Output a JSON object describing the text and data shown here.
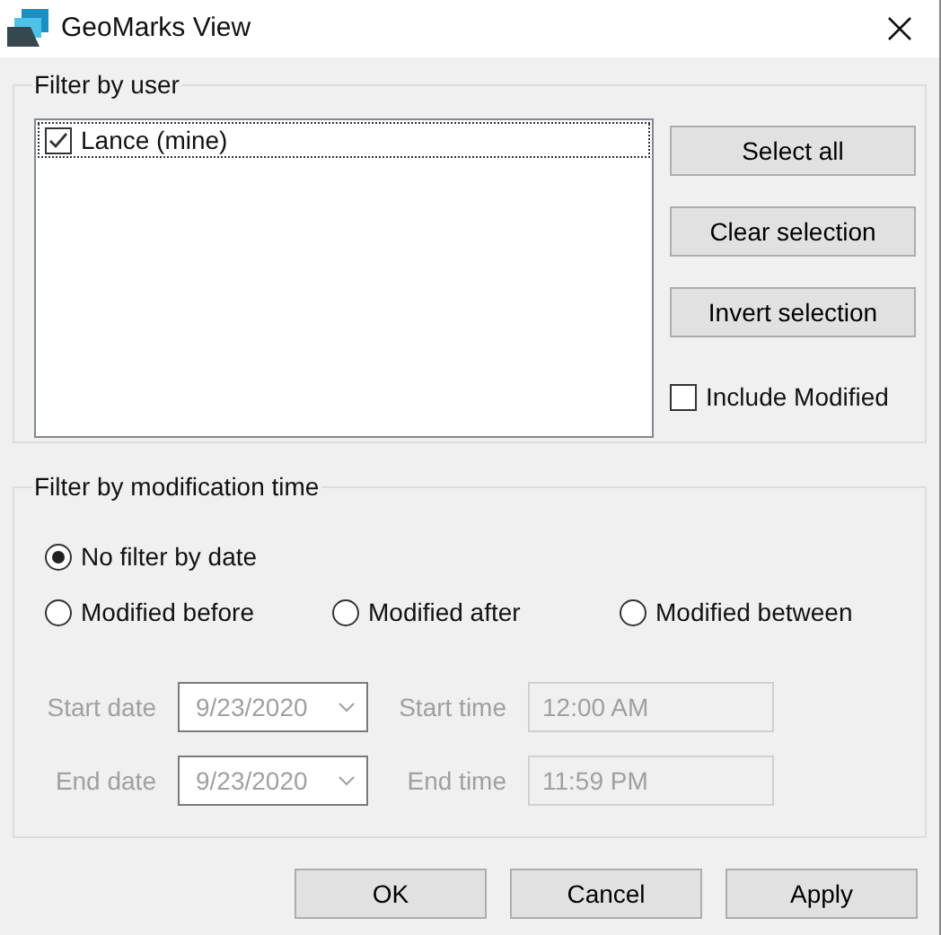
{
  "window": {
    "title": "GeoMarks View"
  },
  "user_filter": {
    "title": "Filter by user",
    "users": [
      {
        "label": "Lance (mine)",
        "checked": true,
        "selected": true
      }
    ],
    "buttons": [
      "Select all",
      "Clear selection",
      "Invert selection"
    ],
    "include_modified": {
      "label": "Include Modified",
      "checked": false
    }
  },
  "time_filter": {
    "title": "Filter by modification time",
    "options": [
      {
        "label": "No filter by date",
        "selected": true
      },
      {
        "label": "Modified before",
        "selected": false
      },
      {
        "label": "Modified after",
        "selected": false
      },
      {
        "label": "Modified between",
        "selected": false
      }
    ],
    "ranges": [
      {
        "date_label": "Start date",
        "date": "9/23/2020",
        "time_label": "Start time",
        "time": "12:00 AM",
        "disabled": true
      },
      {
        "date_label": "End date",
        "date": "9/23/2020",
        "time_label": "End time",
        "time": "11:59 PM",
        "disabled": true
      }
    ]
  },
  "buttons": [
    "OK",
    "Cancel",
    "Apply"
  ]
}
